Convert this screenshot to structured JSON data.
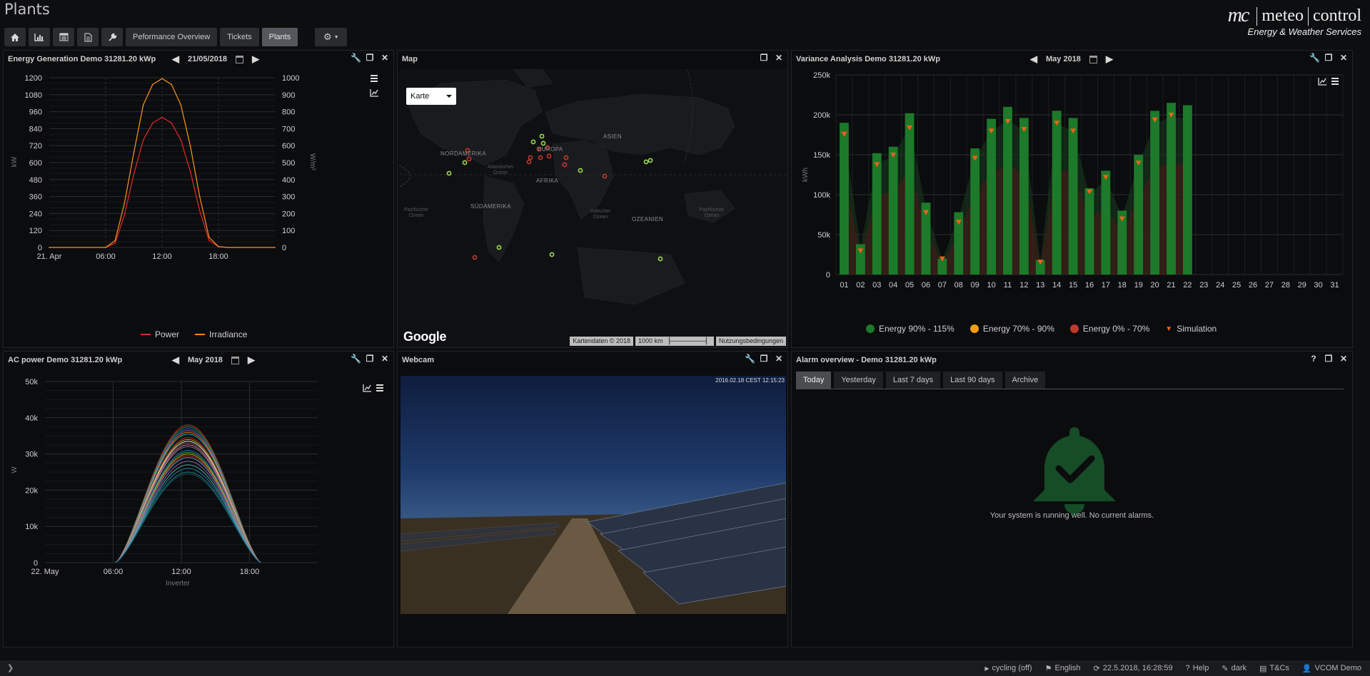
{
  "page": {
    "title": "Plants"
  },
  "toolbar": {
    "icons": [
      "home-icon",
      "bar-chart-icon",
      "calendar-icon",
      "document-icon",
      "wrench-icon"
    ],
    "tabs": [
      "Peformance Overview",
      "Tickets",
      "Plants"
    ],
    "active_tab": "Plants"
  },
  "logo": {
    "brand_left": "meteo",
    "brand_right": "control",
    "tagline": "Energy & Weather Services"
  },
  "panels": {
    "energy": {
      "title": "Energy Generation Demo 31281.20 kWp",
      "date": "21/05/2018",
      "y_left_label": "kW",
      "y_right_label": "W/m²",
      "legend": [
        "Power",
        "Irradiance"
      ]
    },
    "map": {
      "title": "Map",
      "select_value": "Karte",
      "labels": [
        "NORDAMERIKA",
        "EUROPA",
        "ASIEN",
        "AFRIKA",
        "SÜDAMERIKA",
        "OZEANIEN"
      ],
      "ocean_labels": [
        "Atlantischer Ozean",
        "Indischer Ozean",
        "Pazifischer Ozean",
        "Pazifischer Ozean"
      ],
      "google": "Google",
      "attribution": "Kartendaten © 2018",
      "scale": "1000 km",
      "terms": "Nutzungsbedingungen"
    },
    "variance": {
      "title": "Variance Analysis Demo 31281.20 kWp",
      "date": "May 2018",
      "y_label": "kWh",
      "legend": [
        "Energy 90% - 115%",
        "Energy 70% - 90%",
        "Energy 0% - 70%",
        "Simulation"
      ]
    },
    "ac": {
      "title": "AC power Demo 31281.20 kWp",
      "date": "May 2018",
      "y_label": "W",
      "x_label": "Inverter"
    },
    "webcam": {
      "title": "Webcam",
      "timestamp": "2016.02.18 CEST 12:15:23"
    },
    "alarm": {
      "title": "Alarm overview - Demo 31281.20 kWp",
      "tabs": [
        "Today",
        "Yesterday",
        "Last 7 days",
        "Last 90 days",
        "Archive"
      ],
      "active_tab": "Today",
      "message": "Your system is running well. No current alarms."
    }
  },
  "status": {
    "cycling": "cycling (off)",
    "language": "English",
    "timestamp": "22.5.2018, 16:28:59",
    "help": "Help",
    "theme": "dark",
    "tcs": "T&Cs",
    "user": "VCOM Demo"
  },
  "colors": {
    "power": "#d6282b",
    "irradiance": "#f08a1c",
    "green": "#1c7a2a",
    "orange": "#f39c12",
    "red": "#c0392b",
    "simulation": "#e8651a",
    "lightgreen": "#9bdc4a"
  },
  "chart_data": [
    {
      "type": "line",
      "title": "Energy Generation Demo 31281.20 kWp",
      "x_tick_labels": [
        "21. Apr",
        "06:00",
        "12:00",
        "18:00"
      ],
      "x": [
        "00:00",
        "06:00",
        "07:00",
        "08:00",
        "09:00",
        "10:00",
        "11:00",
        "12:00",
        "13:00",
        "14:00",
        "15:00",
        "16:00",
        "17:00",
        "18:00",
        "19:00",
        "20:00",
        "24:00"
      ],
      "ylim_left": [
        0,
        1200
      ],
      "yticks_left": [
        0,
        120,
        240,
        360,
        480,
        600,
        720,
        840,
        960,
        1080,
        1200
      ],
      "ylim_right": [
        0,
        1000
      ],
      "yticks_right": [
        0,
        100,
        200,
        300,
        400,
        500,
        600,
        700,
        800,
        900,
        1000
      ],
      "ylabel_left": "kW",
      "ylabel_right": "W/m²",
      "series": [
        {
          "name": "Power",
          "axis": "left",
          "values": [
            0,
            0,
            30,
            230,
            520,
            760,
            880,
            920,
            880,
            760,
            540,
            260,
            50,
            5,
            0,
            0,
            0
          ]
        },
        {
          "name": "Irradiance",
          "axis": "right",
          "values": [
            0,
            0,
            40,
            260,
            560,
            840,
            960,
            995,
            960,
            840,
            600,
            300,
            60,
            5,
            0,
            0,
            0
          ]
        }
      ]
    },
    {
      "type": "bar",
      "title": "Variance Analysis Demo 31281.20 kWp",
      "categories": [
        "01",
        "02",
        "03",
        "04",
        "05",
        "06",
        "07",
        "08",
        "09",
        "10",
        "11",
        "12",
        "13",
        "14",
        "15",
        "16",
        "17",
        "18",
        "19",
        "20",
        "21",
        "22",
        "23",
        "24",
        "25",
        "26",
        "27",
        "28",
        "29",
        "30",
        "31"
      ],
      "ylim": [
        0,
        250000
      ],
      "yticks": [
        "0",
        "50k",
        "100k",
        "150k",
        "200k",
        "250k"
      ],
      "ylabel": "kWh",
      "series": [
        {
          "name": "Energy",
          "values": [
            190000,
            38000,
            152000,
            160000,
            202000,
            90000,
            20000,
            78000,
            158000,
            195000,
            210000,
            196000,
            18000,
            205000,
            196000,
            108000,
            130000,
            80000,
            150000,
            205000,
            215000,
            212000,
            null,
            null,
            null,
            null,
            null,
            null,
            null,
            null,
            null
          ]
        },
        {
          "name": "Simulation",
          "values": [
            176000,
            30000,
            138000,
            150000,
            184000,
            78000,
            20000,
            66000,
            146000,
            180000,
            192000,
            182000,
            16000,
            190000,
            180000,
            104000,
            122000,
            70000,
            140000,
            194000,
            200000,
            null,
            null,
            null,
            null,
            null,
            null,
            null,
            null,
            null,
            null
          ]
        }
      ]
    },
    {
      "type": "line",
      "title": "AC power Demo 31281.20 kWp",
      "x_tick_labels": [
        "22. May",
        "06:00",
        "12:00",
        "18:00"
      ],
      "ylim": [
        0,
        50000
      ],
      "yticks": [
        "0",
        "10k",
        "20k",
        "30k",
        "40k",
        "50k"
      ],
      "ylabel": "W",
      "xlabel": "Inverter",
      "series_peaks_W": [
        38000,
        37500,
        37000,
        36500,
        36000,
        35500,
        34500,
        34000,
        33500,
        33000,
        32500,
        32000,
        31000,
        30500,
        30000,
        29500,
        29000,
        28000,
        27000,
        26000,
        25000,
        24500
      ]
    }
  ]
}
